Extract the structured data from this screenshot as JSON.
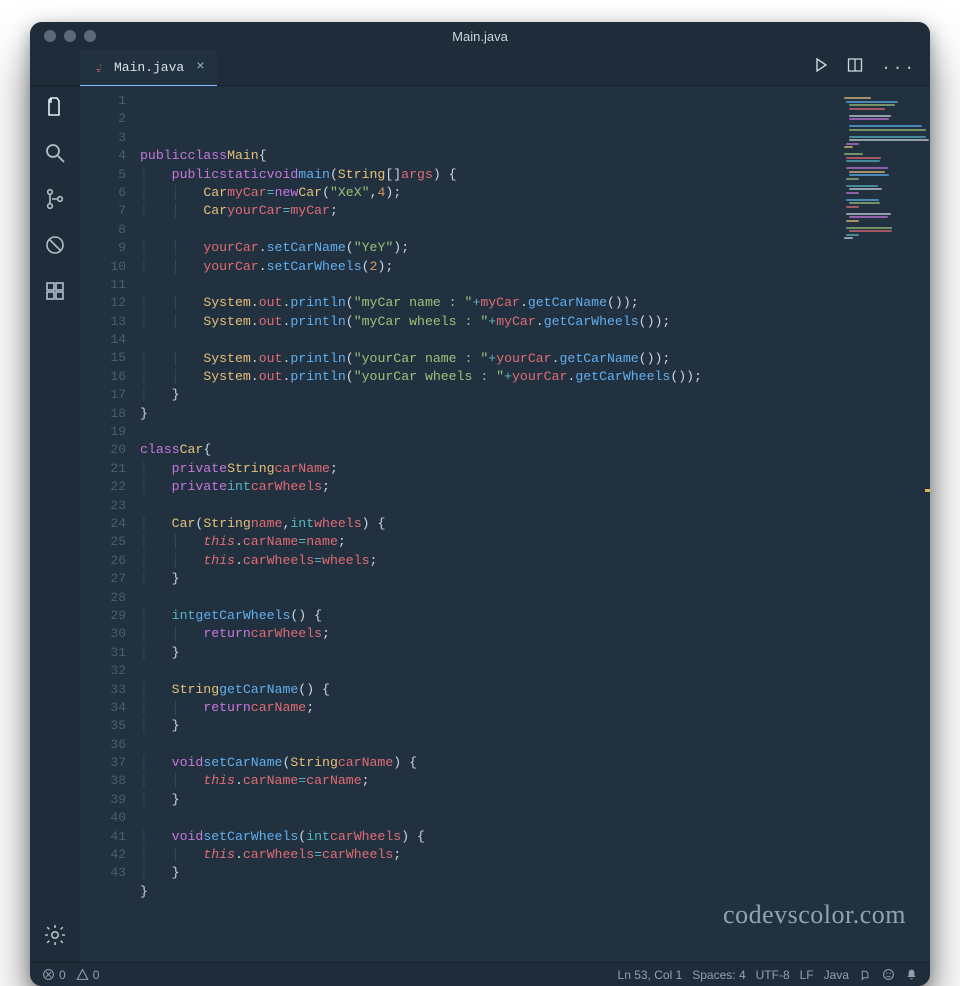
{
  "window": {
    "title": "Main.java"
  },
  "tab": {
    "label": "Main.java"
  },
  "statusbar": {
    "errors": "0",
    "warnings": "0",
    "cursor": "Ln 53, Col 1",
    "spaces": "Spaces: 4",
    "encoding": "UTF-8",
    "eol": "LF",
    "lang": "Java"
  },
  "watermark": "codevscolor.com",
  "code": {
    "lines": [
      {
        "n": 1,
        "html": ""
      },
      {
        "n": 2,
        "html": "<span class='kw'>public</span> <span class='kw'>class</span> <span class='type'>Main</span> <span class='pun'>{</span>"
      },
      {
        "n": 3,
        "html": "    <span class='kw'>public</span> <span class='kw'>static</span> <span class='kw'>void</span> <span class='fn'>main</span><span class='pun'>(</span><span class='type'>String</span><span class='pun'>[]</span> <span class='id'>args</span><span class='pun'>) {</span>"
      },
      {
        "n": 4,
        "html": "        <span class='type'>Car</span> <span class='id'>myCar</span> <span class='op'>=</span> <span class='kw'>new</span> <span class='type'>Car</span><span class='pun'>(</span><span class='str'>\"XeX\"</span><span class='pun'>,</span> <span class='num'>4</span><span class='pun'>);</span>"
      },
      {
        "n": 5,
        "html": "        <span class='type'>Car</span> <span class='id'>yourCar</span> <span class='op'>=</span> <span class='id'>myCar</span><span class='pun'>;</span>"
      },
      {
        "n": 6,
        "html": ""
      },
      {
        "n": 7,
        "html": "        <span class='id'>yourCar</span><span class='pun'>.</span><span class='fn'>setCarName</span><span class='pun'>(</span><span class='str'>\"YeY\"</span><span class='pun'>);</span>"
      },
      {
        "n": 8,
        "html": "        <span class='id'>yourCar</span><span class='pun'>.</span><span class='fn'>setCarWheels</span><span class='pun'>(</span><span class='num'>2</span><span class='pun'>);</span>"
      },
      {
        "n": 9,
        "html": ""
      },
      {
        "n": 10,
        "html": "        <span class='type'>System</span><span class='pun'>.</span><span class='id'>out</span><span class='pun'>.</span><span class='fn'>println</span><span class='pun'>(</span><span class='str'>\"myCar name : \"</span> <span class='op'>+</span> <span class='id'>myCar</span><span class='pun'>.</span><span class='fn'>getCarName</span><span class='pun'>());</span>"
      },
      {
        "n": 11,
        "html": "        <span class='type'>System</span><span class='pun'>.</span><span class='id'>out</span><span class='pun'>.</span><span class='fn'>println</span><span class='pun'>(</span><span class='str'>\"myCar wheels : \"</span> <span class='op'>+</span> <span class='id'>myCar</span><span class='pun'>.</span><span class='fn'>getCarWheels</span><span class='pun'>());</span>"
      },
      {
        "n": 12,
        "html": ""
      },
      {
        "n": 13,
        "html": "        <span class='type'>System</span><span class='pun'>.</span><span class='id'>out</span><span class='pun'>.</span><span class='fn'>println</span><span class='pun'>(</span><span class='str'>\"yourCar name : \"</span> <span class='op'>+</span> <span class='id'>yourCar</span><span class='pun'>.</span><span class='fn'>getCarName</span><span class='pun'>());</span>"
      },
      {
        "n": 14,
        "html": "        <span class='type'>System</span><span class='pun'>.</span><span class='id'>out</span><span class='pun'>.</span><span class='fn'>println</span><span class='pun'>(</span><span class='str'>\"yourCar wheels : \"</span> <span class='op'>+</span> <span class='id'>yourCar</span><span class='pun'>.</span><span class='fn'>getCarWheels</span><span class='pun'>());</span>"
      },
      {
        "n": 15,
        "html": "    <span class='pun'>}</span>"
      },
      {
        "n": 16,
        "html": "<span class='pun'>}</span>"
      },
      {
        "n": 17,
        "html": ""
      },
      {
        "n": 18,
        "html": "<span class='kw'>class</span> <span class='type'>Car</span> <span class='pun'>{</span>"
      },
      {
        "n": 19,
        "html": "    <span class='kw'>private</span> <span class='type'>String</span> <span class='id'>carName</span><span class='pun'>;</span>"
      },
      {
        "n": 20,
        "html": "    <span class='kw'>private</span> <span class='t2'>int</span> <span class='id'>carWheels</span><span class='pun'>;</span>"
      },
      {
        "n": 21,
        "html": ""
      },
      {
        "n": 22,
        "html": "    <span class='type'>Car</span><span class='pun'>(</span><span class='type'>String</span> <span class='id'>name</span><span class='pun'>,</span> <span class='t2'>int</span> <span class='id'>wheels</span><span class='pun'>) {</span>"
      },
      {
        "n": 23,
        "html": "        <span class='this'>this</span><span class='pun'>.</span><span class='id'>carName</span> <span class='op'>=</span> <span class='id'>name</span><span class='pun'>;</span>"
      },
      {
        "n": 24,
        "html": "        <span class='this'>this</span><span class='pun'>.</span><span class='id'>carWheels</span> <span class='op'>=</span> <span class='id'>wheels</span><span class='pun'>;</span>"
      },
      {
        "n": 25,
        "html": "    <span class='pun'>}</span>"
      },
      {
        "n": 26,
        "html": ""
      },
      {
        "n": 27,
        "html": "    <span class='t2'>int</span> <span class='fn'>getCarWheels</span><span class='pun'>() {</span>"
      },
      {
        "n": 28,
        "html": "        <span class='kw'>return</span> <span class='id'>carWheels</span><span class='pun'>;</span>"
      },
      {
        "n": 29,
        "html": "    <span class='pun'>}</span>"
      },
      {
        "n": 30,
        "html": ""
      },
      {
        "n": 31,
        "html": "    <span class='type'>String</span> <span class='fn'>getCarName</span><span class='pun'>() {</span>"
      },
      {
        "n": 32,
        "html": "        <span class='kw'>return</span> <span class='id'>carName</span><span class='pun'>;</span>"
      },
      {
        "n": 33,
        "html": "    <span class='pun'>}</span>"
      },
      {
        "n": 34,
        "html": ""
      },
      {
        "n": 35,
        "html": "    <span class='kw'>void</span> <span class='fn'>setCarName</span><span class='pun'>(</span><span class='type'>String</span> <span class='id'>carName</span><span class='pun'>) {</span>"
      },
      {
        "n": 36,
        "html": "        <span class='this'>this</span><span class='pun'>.</span><span class='id'>carName</span> <span class='op'>=</span> <span class='id'>carName</span><span class='pun'>;</span>"
      },
      {
        "n": 37,
        "html": "    <span class='pun'>}</span>"
      },
      {
        "n": 38,
        "html": ""
      },
      {
        "n": 39,
        "html": "    <span class='kw'>void</span> <span class='fn'>setCarWheels</span><span class='pun'>(</span><span class='t2'>int</span> <span class='id'>carWheels</span><span class='pun'>) {</span>"
      },
      {
        "n": 40,
        "html": "        <span class='this'>this</span><span class='pun'>.</span><span class='id'>carWheels</span> <span class='op'>=</span> <span class='id'>carWheels</span><span class='pun'>;</span>"
      },
      {
        "n": 41,
        "html": "    <span class='pun'>}</span>"
      },
      {
        "n": 42,
        "html": "<span class='pun'>}</span>"
      },
      {
        "n": 43,
        "html": ""
      }
    ]
  }
}
